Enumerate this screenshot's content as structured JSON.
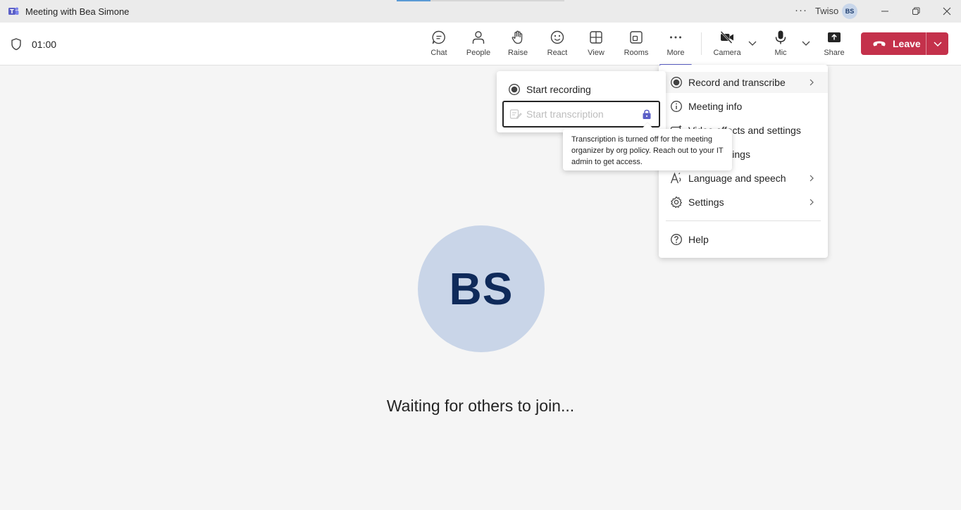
{
  "window": {
    "title": "Meeting with Bea Simone",
    "more_dots": "···",
    "user_name": "Twiso",
    "user_initials": "BS"
  },
  "toolbar": {
    "timer": "01:00",
    "buttons": {
      "chat": "Chat",
      "people": "People",
      "raise": "Raise",
      "react": "React",
      "view": "View",
      "rooms": "Rooms",
      "more": "More",
      "camera": "Camera",
      "mic": "Mic",
      "share": "Share"
    },
    "leave_label": "Leave",
    "leave_color": "#c4314b",
    "accent_color": "#5b5fc7"
  },
  "main": {
    "avatar_initials": "BS",
    "waiting_text": "Waiting for others to join..."
  },
  "more_menu": {
    "items": [
      {
        "label": "Record and transcribe",
        "icon": "record-icon",
        "has_submenu": true
      },
      {
        "label": "Meeting info",
        "icon": "info-icon",
        "has_submenu": false
      },
      {
        "label": "Video effects and settings",
        "icon": "video-effects-icon",
        "has_submenu": false
      },
      {
        "label": "Audio settings",
        "icon": "audio-settings-icon",
        "has_submenu": false
      },
      {
        "label": "Language and speech",
        "icon": "language-icon",
        "has_submenu": true
      },
      {
        "label": "Settings",
        "icon": "gear-icon",
        "has_submenu": true
      },
      {
        "label": "Help",
        "icon": "help-icon",
        "has_submenu": false
      }
    ]
  },
  "submenu": {
    "start_recording": "Start recording",
    "start_transcription": "Start transcription"
  },
  "tooltip": {
    "text": "Transcription is turned off for the meeting organizer by org policy. Reach out to your IT admin to get access."
  }
}
